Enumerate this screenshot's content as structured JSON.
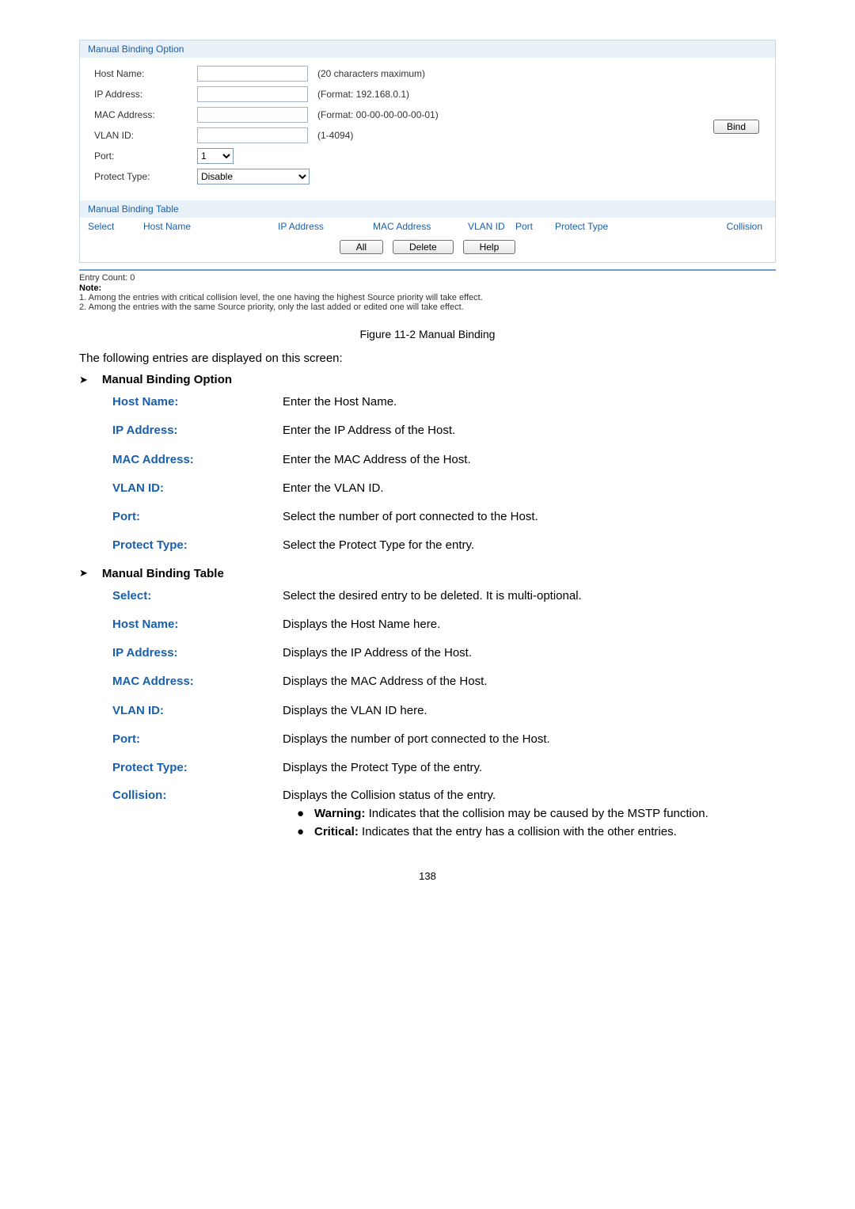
{
  "panel": {
    "optionHeader": "Manual Binding Option",
    "tableHeader": "Manual Binding Table",
    "labels": {
      "hostName": "Host Name:",
      "ipAddress": "IP Address:",
      "macAddress": "MAC Address:",
      "vlanId": "VLAN ID:",
      "port": "Port:",
      "protectType": "Protect Type:"
    },
    "hints": {
      "hostName": "(20 characters maximum)",
      "ipAddress": "(Format: 192.168.0.1)",
      "macAddress": "(Format: 00-00-00-00-00-01)",
      "vlanId": "(1-4094)"
    },
    "portValue": "1",
    "protectValue": "Disable",
    "bindBtn": "Bind",
    "cols": {
      "select": "Select",
      "hostName": "Host Name",
      "ip": "IP Address",
      "mac": "MAC Address",
      "vlan": "VLAN ID",
      "port": "Port",
      "ptype": "Protect Type",
      "collision": "Collision"
    },
    "buttons": {
      "all": "All",
      "delete": "Delete",
      "help": "Help"
    },
    "entryCount": "Entry Count: 0",
    "noteLabel": "Note:",
    "note1": "1. Among the entries with critical collision level, the one having the highest Source priority will take effect.",
    "note2": "2. Among the entries with the same Source priority, only the last added or edited one will take effect."
  },
  "figureCaption": "Figure 11-2 Manual Binding",
  "intro": "The following entries are displayed on this screen:",
  "sectionA": {
    "bullet": "➤",
    "title": "Manual Binding Option",
    "rows": [
      {
        "term": "Host Name:",
        "desc": "Enter the Host Name."
      },
      {
        "term": "IP Address:",
        "desc": "Enter the IP Address of the Host."
      },
      {
        "term": "MAC Address:",
        "desc": "Enter the MAC Address of the Host."
      },
      {
        "term": "VLAN ID:",
        "desc": "Enter the VLAN ID."
      },
      {
        "term": "Port:",
        "desc": "Select the number of port connected to the Host."
      },
      {
        "term": "Protect Type:",
        "desc": "Select the Protect Type for the entry."
      }
    ]
  },
  "sectionB": {
    "bullet": "➤",
    "title": "Manual Binding Table",
    "rows": [
      {
        "term": "Select:",
        "desc": "Select the desired entry to be deleted. It is multi-optional."
      },
      {
        "term": "Host Name:",
        "desc": "Displays the Host Name here."
      },
      {
        "term": "IP Address:",
        "desc": "Displays the IP Address of the Host."
      },
      {
        "term": "MAC Address:",
        "desc": "Displays the MAC Address of the Host."
      },
      {
        "term": "VLAN ID:",
        "desc": "Displays the VLAN ID here."
      },
      {
        "term": "Port:",
        "desc": "Displays the number of port connected to the Host."
      },
      {
        "term": "Protect Type:",
        "desc": "Displays the Protect Type of the entry."
      }
    ],
    "collision": {
      "term": "Collision:",
      "desc": "Displays the Collision status of the entry.",
      "bullets": [
        {
          "bold": "Warning:",
          "rest": " Indicates that the collision may be caused by the MSTP function."
        },
        {
          "bold": "Critical:",
          "rest": " Indicates that the entry has a collision with the other entries."
        }
      ]
    }
  },
  "pageNumber": "138"
}
